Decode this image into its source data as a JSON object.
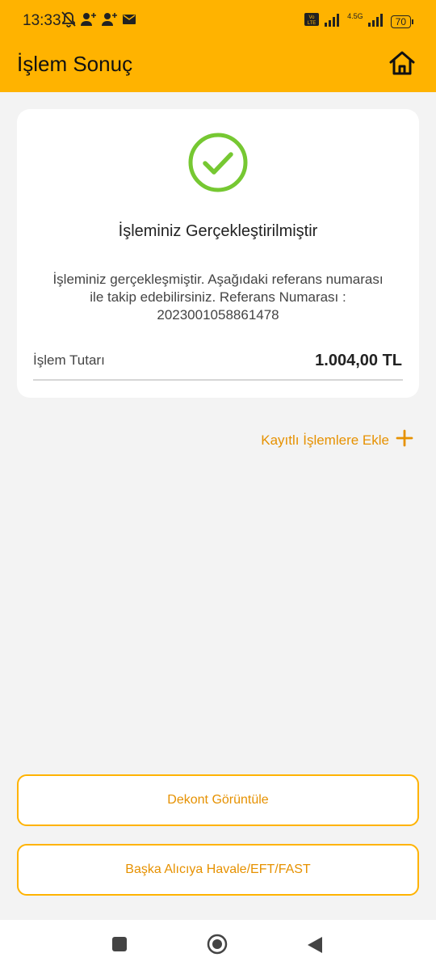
{
  "status_bar": {
    "time": "13:33",
    "network": "4.5G",
    "volte": "Vo LTE",
    "battery": "70",
    "icons_left": [
      "notifications-off-icon",
      "person-add-icon",
      "person-add-icon",
      "mail-icon"
    ],
    "icons_right": [
      "volte-icon",
      "signal-icon",
      "signal-icon",
      "battery-icon"
    ]
  },
  "header": {
    "title": "İşlem Sonuç",
    "home_icon": "home-icon"
  },
  "result": {
    "icon": "check-circle-icon",
    "title": "İşleminiz Gerçekleştirilmiştir",
    "description": "İşleminiz gerçekleşmiştir. Aşağıdaki referans numarası ile takip edebilirsiniz. Referans Numarası : 2023001058861478",
    "amount_label": "İşlem Tutarı",
    "amount_value": "1.004,00 TL"
  },
  "actions": {
    "add_saved_label": "Kayıtlı İşlemlere Ekle",
    "add_icon": "plus-icon",
    "dekont_label": "Dekont Görüntüle",
    "havale_label": "Başka Alıcıya Havale/EFT/FAST"
  },
  "nav": {
    "recent_icon": "square-icon",
    "home_icon": "circle-icon",
    "back_icon": "triangle-back-icon"
  },
  "colors": {
    "brand": "#ffb300",
    "accent_text": "#e69100",
    "success": "#76c832"
  }
}
